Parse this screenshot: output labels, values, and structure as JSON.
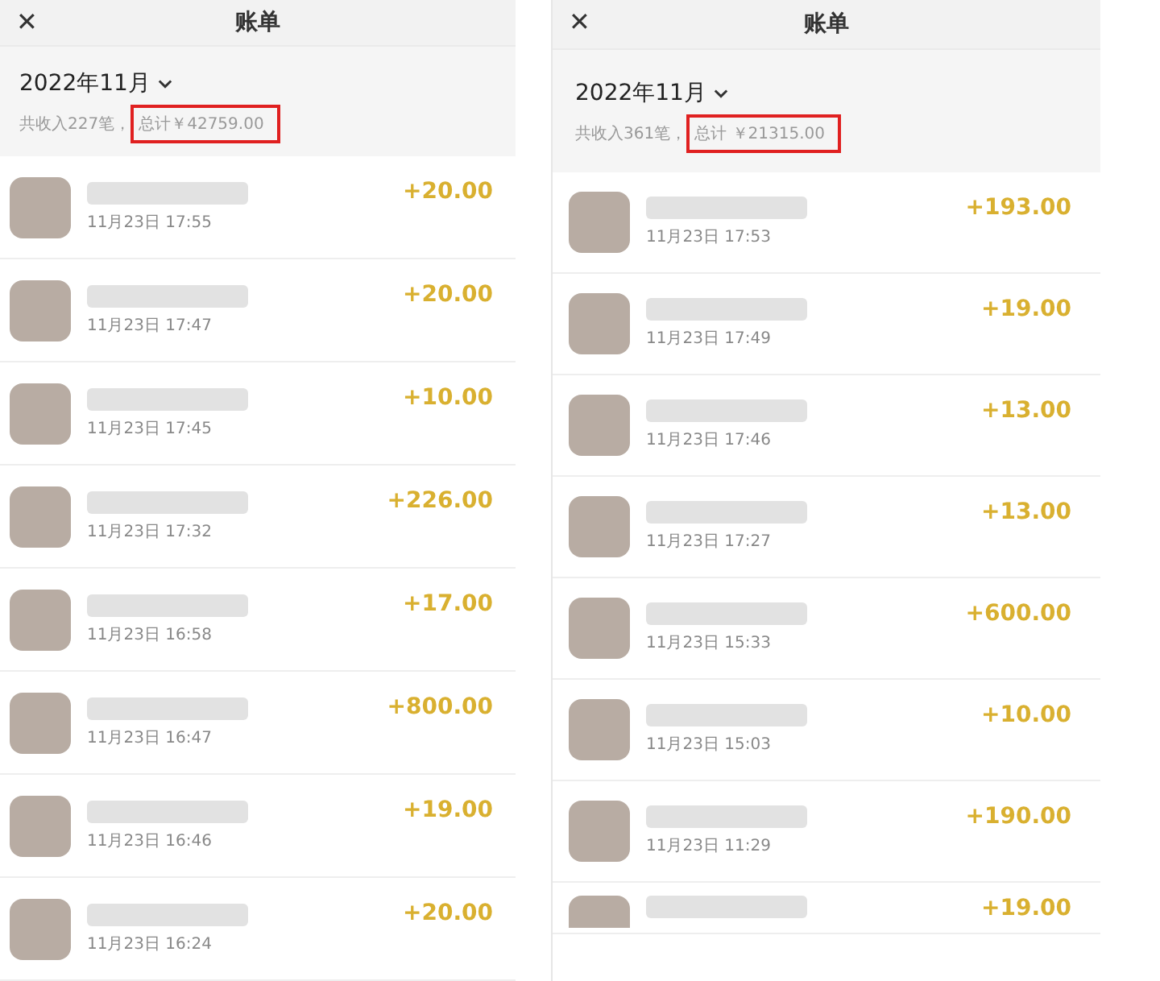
{
  "panels": [
    {
      "close_icon": "✕",
      "title": "账单",
      "month": "2022年11月",
      "count_text": "共收入227笔，",
      "total_text": "总计￥42759.00",
      "total_highlighted": true,
      "rows": [
        {
          "time": "11月23日 17:55",
          "amount": "+20.00"
        },
        {
          "time": "11月23日 17:47",
          "amount": "+20.00"
        },
        {
          "time": "11月23日 17:45",
          "amount": "+10.00"
        },
        {
          "time": "11月23日 17:32",
          "amount": "+226.00"
        },
        {
          "time": "11月23日 16:58",
          "amount": "+17.00"
        },
        {
          "time": "11月23日 16:47",
          "amount": "+800.00"
        },
        {
          "time": "11月23日 16:46",
          "amount": "+19.00"
        },
        {
          "time": "11月23日 16:24",
          "amount": "+20.00"
        }
      ]
    },
    {
      "close_icon": "✕",
      "title": "账单",
      "month": "2022年11月",
      "count_text": "共收入361笔，",
      "total_text": "总计 ￥21315.00",
      "total_highlighted": true,
      "rows": [
        {
          "time": "11月23日 17:53",
          "amount": "+193.00"
        },
        {
          "time": "11月23日 17:49",
          "amount": "+19.00"
        },
        {
          "time": "11月23日 17:46",
          "amount": "+13.00"
        },
        {
          "time": "11月23日 17:27",
          "amount": "+13.00"
        },
        {
          "time": "11月23日 15:33",
          "amount": "+600.00"
        },
        {
          "time": "11月23日 15:03",
          "amount": "+10.00"
        },
        {
          "time": "11月23日 11:29",
          "amount": "+190.00"
        },
        {
          "amount": "+19.00"
        }
      ]
    }
  ]
}
